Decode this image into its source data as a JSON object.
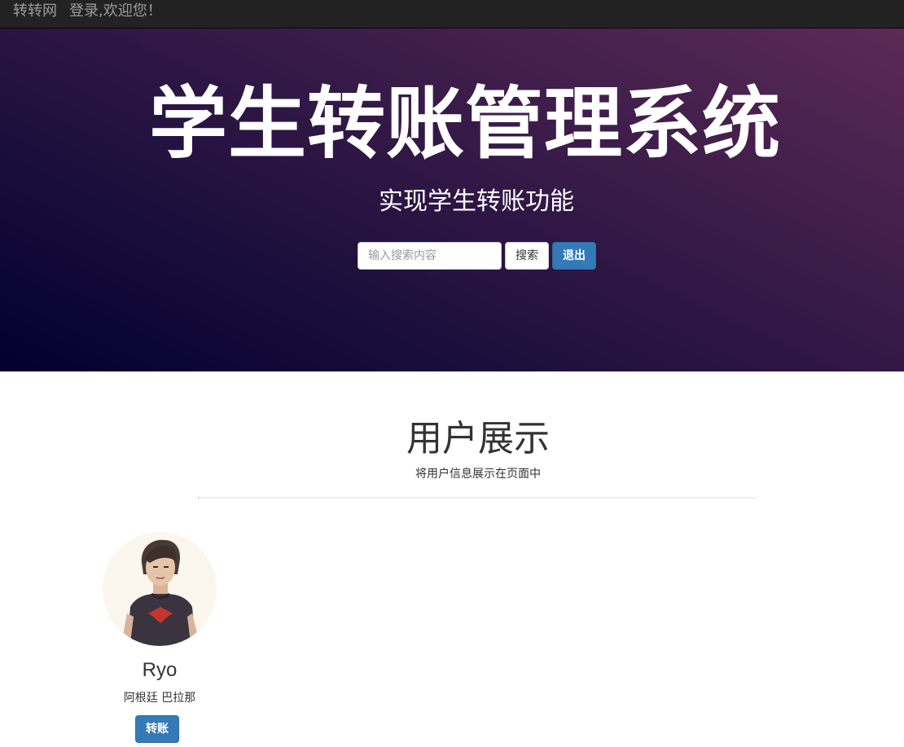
{
  "navbar": {
    "brand": "转转网",
    "login_link": "登录,欢迎您！"
  },
  "hero": {
    "title": "学生转账管理系统",
    "subtitle": "实现学生转账功能",
    "search": {
      "placeholder": "输入搜索内容",
      "value": ""
    },
    "search_button_label": "搜索",
    "logout_button_label": "退出"
  },
  "section": {
    "title": "用户展示",
    "subtitle": "将用户信息展示在页面中"
  },
  "users": [
    {
      "name": "Ryo",
      "description": "阿根廷 巴拉那",
      "transfer_button_label": "转账",
      "avatar": "user-avatar-illustration"
    }
  ],
  "colors": {
    "navbar_bg": "#222222",
    "navbar_text": "#9d9d9d",
    "hero_gradient_start": "#02002e",
    "hero_gradient_end": "#5c2a55",
    "primary_button": "#337ab7"
  }
}
